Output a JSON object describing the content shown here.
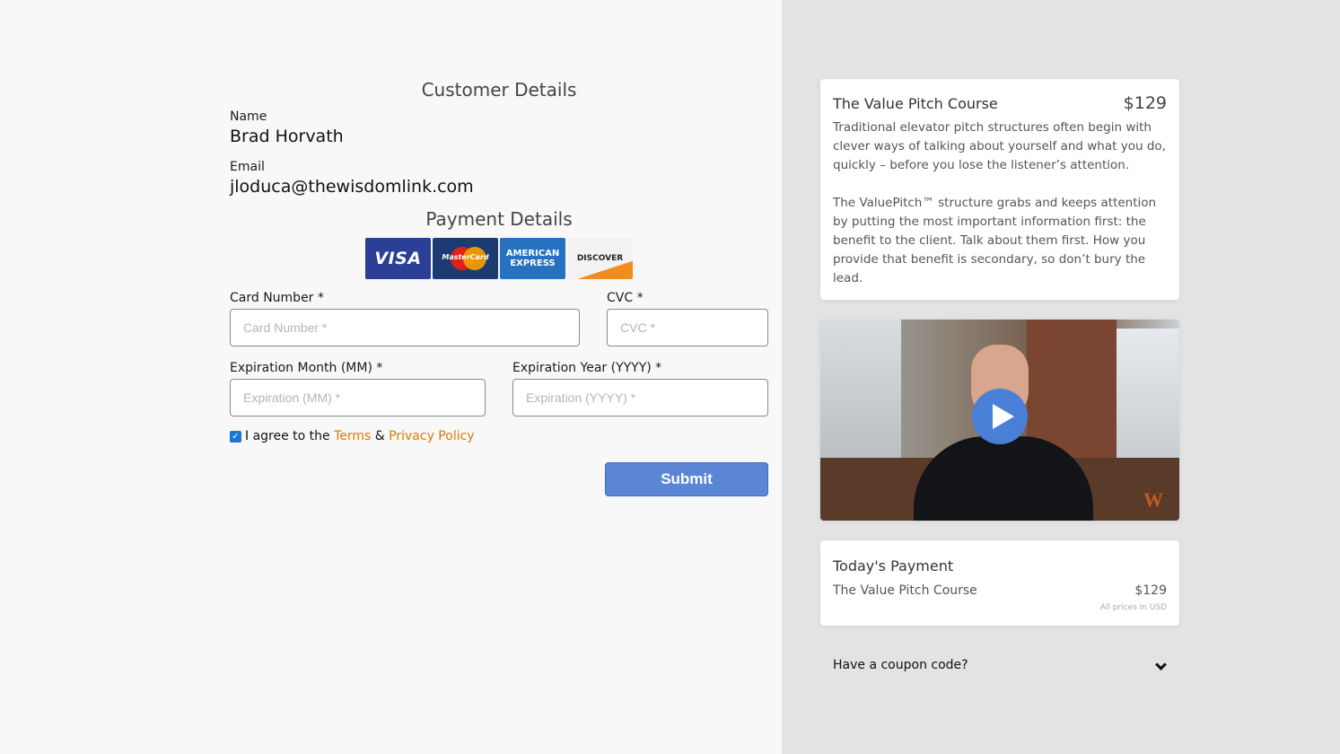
{
  "customer": {
    "title": "Customer Details",
    "name_label": "Name",
    "name_value": "Brad Horvath",
    "email_label": "Email",
    "email_value": "jloduca@thewisdomlink.com"
  },
  "payment": {
    "title": "Payment Details",
    "card_logos": [
      "VISA",
      "MasterCard",
      "AMERICAN EXPRESS",
      "DISCOVER"
    ],
    "card_number_label": "Card Number *",
    "card_number_placeholder": "Card Number *",
    "cvc_label": "CVC *",
    "cvc_placeholder": "CVC *",
    "exp_month_label": "Expiration Month (MM) *",
    "exp_month_placeholder": "Expiration (MM) *",
    "exp_year_label": "Expiration Year (YYYY) *",
    "exp_year_placeholder": "Expiration (YYYY) *",
    "agree_text_1": "I agree to the ",
    "terms_link": "Terms",
    "agree_text_2": " & ",
    "privacy_link": "Privacy Policy",
    "agree_checked": true,
    "submit_label": "Submit"
  },
  "course": {
    "title": "The Value Pitch Course",
    "price": "$129",
    "description_p1": "Traditional elevator pitch structures often begin with clever ways of talking about yourself and what you do, quickly – before you lose the listener’s attention.",
    "description_p2": "The ValuePitch™ structure grabs and keeps attention by putting the most important information first: the benefit to the client. Talk about them first. How you provide that benefit is secondary, so don’t bury the lead."
  },
  "video": {
    "watermark": "W"
  },
  "todays_payment": {
    "title": "Today's Payment",
    "item": "The Value Pitch Course",
    "price": "$129",
    "note": "All prices in USD"
  },
  "coupon": {
    "label": "Have a coupon code?"
  },
  "colors": {
    "accent": "#5b86d6",
    "link": "#d97a00",
    "right_bg": "#e3e3e3"
  }
}
